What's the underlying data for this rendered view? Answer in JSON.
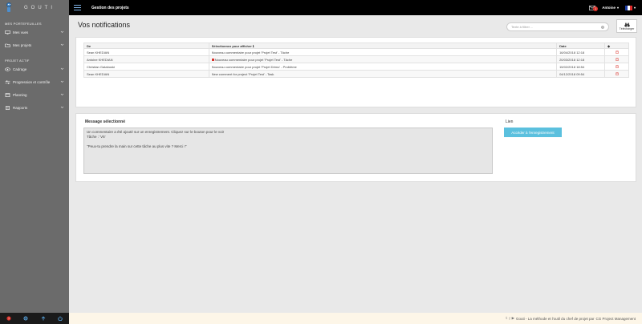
{
  "brand": {
    "name": "GOUTI",
    "logo_colors": {
      "fill": "#4b8fd1"
    }
  },
  "sidebar": {
    "section1_title": "Mes portefeuilles",
    "section2_title": "Projet actif",
    "items": [
      {
        "label": "Mes vues",
        "icon": "monitor-icon"
      },
      {
        "label": "Mes projets",
        "icon": "folder-icon"
      },
      {
        "label": "Cadrage",
        "icon": "eye-icon"
      },
      {
        "label": "Progression et contrôle",
        "icon": "sliders-icon"
      },
      {
        "label": "Planning",
        "icon": "calendar-icon"
      },
      {
        "label": "Rapports",
        "icon": "document-icon"
      }
    ]
  },
  "topbar": {
    "title": "Gestion des projets",
    "notification_count": "1",
    "user": "Antoine",
    "language": "FR"
  },
  "main": {
    "page_title": "Vos notifications",
    "filter_placeholder": "Texte à filtrer ...",
    "download_label": "Télécharger"
  },
  "table": {
    "headers": {
      "de": "De",
      "selection": "Sélectionnez pour afficher",
      "date": "Date"
    },
    "rows": [
      {
        "de": "Sean KHEDIAN",
        "message": "Nouveau commentaire pour projet 'Projet Test' - Tâche",
        "date": "16/04/2018 12:18",
        "unread": false
      },
      {
        "de": "Antoine KHEDIAN",
        "message": "Nouveau commentaire pour projet 'Projet Test' - Tâche",
        "date": "20/03/2018 12:18",
        "unread": true
      },
      {
        "de": "Christian Gatabuski",
        "message": "Nouveau commentaire pour projet 'Projet Démo' - Problème",
        "date": "15/02/2018 18:54",
        "unread": false
      },
      {
        "de": "Sean KHEDIAN",
        "message": "New comment for project 'Projet Test' - Task",
        "date": "04/12/2018 09:54",
        "unread": false
      }
    ]
  },
  "selected": {
    "label": "Message sélectionné",
    "text": "Un commentaire a été ajouté sur un enregistrement. Cliquez sur le bouton pour le voir\nTâche : 'V5'\n\n\"Peux-tu prendre la main sur cette tâche au plus vite ? Merci !\""
  },
  "link": {
    "label": "Lien",
    "button": "Accéder à l'enregistrement"
  },
  "footer": {
    "text": "Gouti - La méthode et l'outil du chef de projet par",
    "company": "CG Project Management"
  },
  "colors": {
    "accent": "#5bc0de",
    "sidebar": "#6b6b6b",
    "topbar": "#000000",
    "unread": "#d9322b"
  }
}
